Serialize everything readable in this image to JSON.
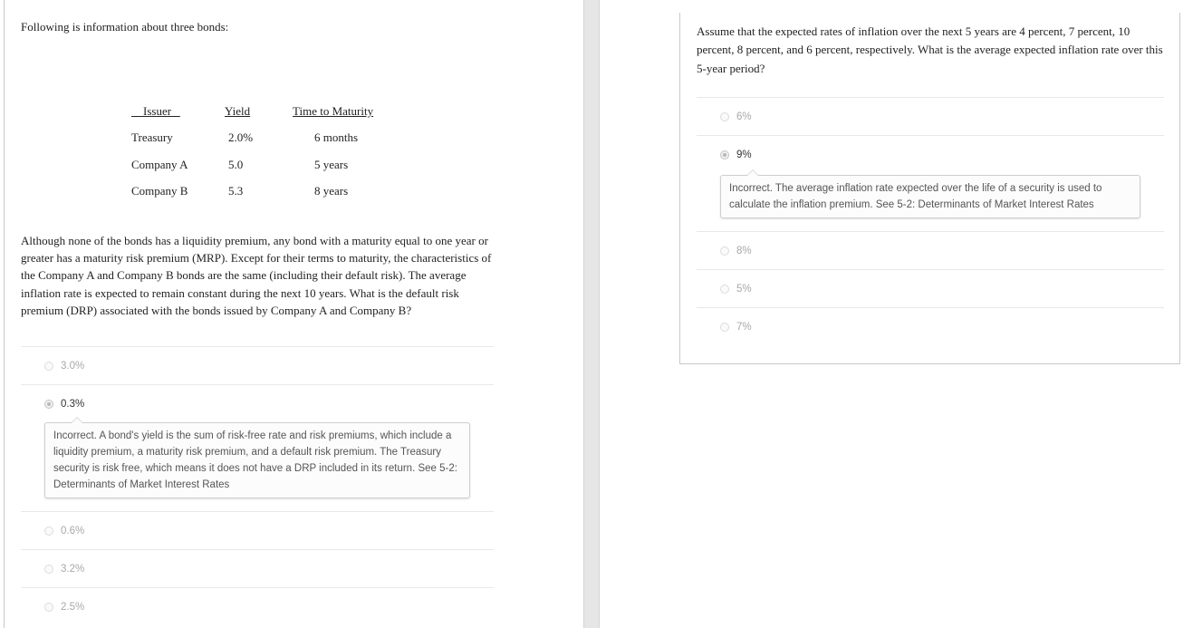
{
  "left_question": {
    "intro": "Following is information about three bonds:",
    "table": {
      "headers": [
        "Issuer",
        "Yield",
        "Time to Maturity"
      ],
      "rows": [
        {
          "issuer": "Treasury",
          "yield": "2.0%",
          "maturity": "6 months"
        },
        {
          "issuer": "Company A",
          "yield": "5.0",
          "maturity": "5 years"
        },
        {
          "issuer": "Company B",
          "yield": "5.3",
          "maturity": "8 years"
        }
      ]
    },
    "prompt": "Although none of the bonds has a liquidity premium, any bond with a maturity equal to one year or greater has a maturity risk premium (MRP). Except for their terms to maturity, the characteristics of the Company A and Company B bonds are the same (including their default risk). The average inflation rate is expected to remain constant during the next 10 years. What is the default risk premium (DRP) associated with the bonds issued by Company A and Company B?",
    "options": [
      {
        "label": "3.0%",
        "selected": false
      },
      {
        "label": "0.3%",
        "selected": true,
        "feedback": "Incorrect. A bond's yield is the sum of risk-free rate and risk premiums, which include a liquidity premium, a maturity risk premium, and a default risk premium. The Treasury security is risk free, which means it does not have a DRP included in its return. See 5-2: Determinants of Market Interest Rates"
      },
      {
        "label": "0.6%",
        "selected": false
      },
      {
        "label": "3.2%",
        "selected": false
      },
      {
        "label": "2.5%",
        "selected": false
      }
    ]
  },
  "right_question": {
    "prompt": "Assume that the expected rates of inflation over the next 5 years are 4 percent, 7 percent, 10 percent, 8 percent, and 6 percent, respectively. What is the average expected inflation rate over this 5-year period?",
    "options": [
      {
        "label": "6%",
        "selected": false
      },
      {
        "label": "9%",
        "selected": true,
        "feedback": "Incorrect. The average inflation rate expected over the life of a security is used to calculate the inflation premium. See 5-2: Determinants of Market Interest Rates"
      },
      {
        "label": "8%",
        "selected": false
      },
      {
        "label": "5%",
        "selected": false
      },
      {
        "label": "7%",
        "selected": false
      }
    ]
  }
}
